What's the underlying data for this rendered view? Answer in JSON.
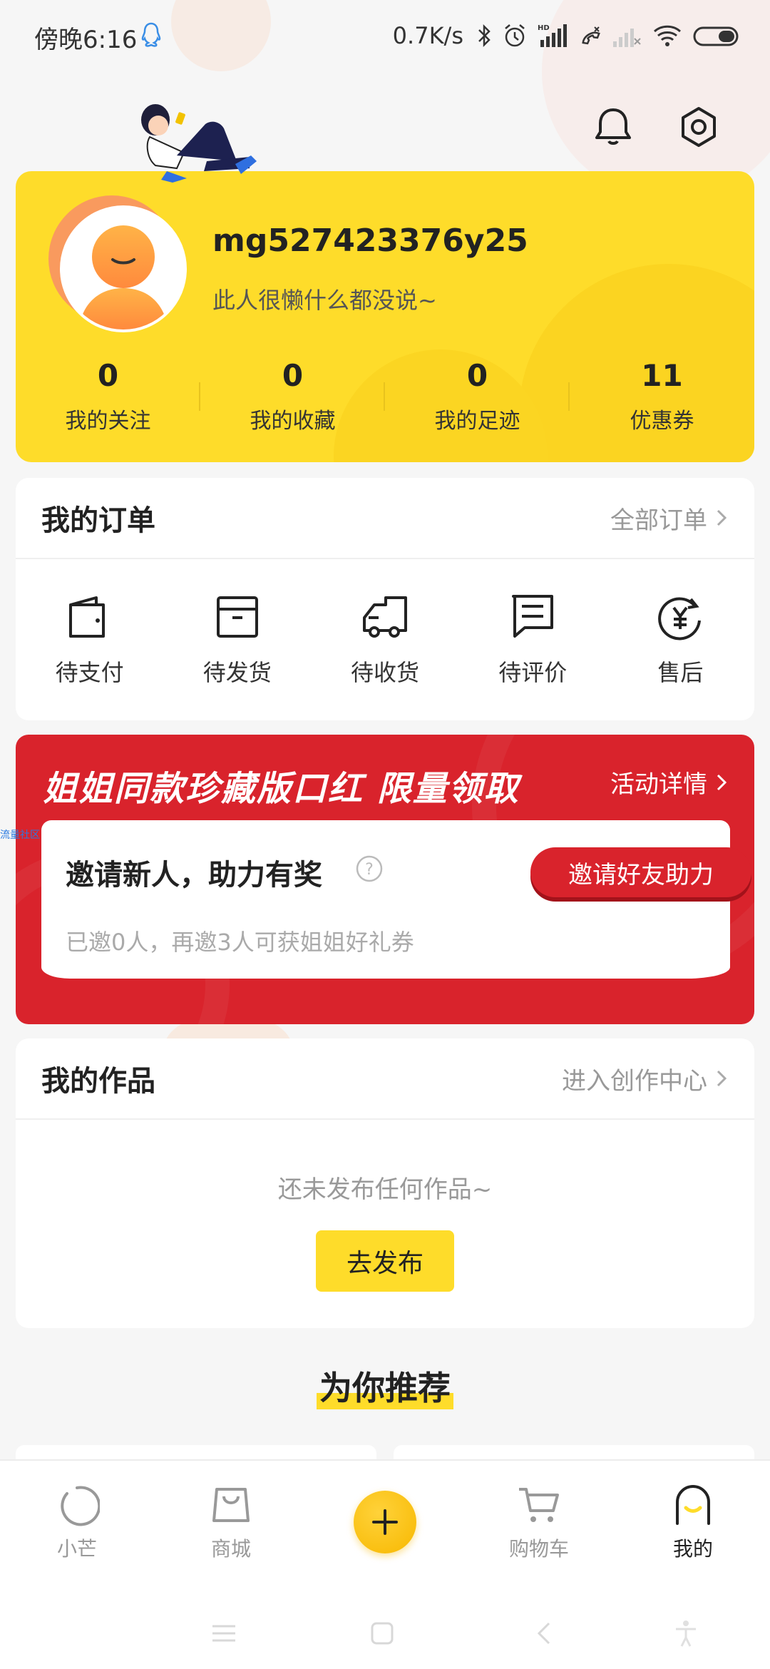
{
  "status_bar": {
    "time": "傍晚6:16",
    "network_speed": "0.7K/s",
    "icons": [
      "qq-icon",
      "bluetooth-icon",
      "alarm-icon",
      "signal-hd-icon",
      "call-icon",
      "signal-2-icon",
      "wifi-icon",
      "battery-icon"
    ]
  },
  "header": {
    "icons": [
      "bell-icon",
      "settings-icon"
    ]
  },
  "profile": {
    "username": "mg527423376y25",
    "bio": "此人很懒什么都没说~",
    "stats": [
      {
        "value": "0",
        "label": "我的关注"
      },
      {
        "value": "0",
        "label": "我的收藏"
      },
      {
        "value": "0",
        "label": "我的足迹"
      },
      {
        "value": "11",
        "label": "优惠券"
      }
    ]
  },
  "orders": {
    "title": "我的订单",
    "all_link": "全部订单",
    "items": [
      {
        "label": "待支付",
        "icon": "wallet-icon"
      },
      {
        "label": "待发货",
        "icon": "box-icon"
      },
      {
        "label": "待收货",
        "icon": "truck-icon"
      },
      {
        "label": "待评价",
        "icon": "comment-icon"
      },
      {
        "label": "售后",
        "icon": "refund-icon"
      }
    ]
  },
  "promo": {
    "title": "姐姐同款珍藏版口红 限量领取",
    "detail_link": "活动详情",
    "invite_title": "邀请新人，助力有奖",
    "invite_button": "邀请好友助力",
    "invite_sub": "已邀0人，再邀3人可获姐姐好礼券",
    "overlay_tag": "流量社区"
  },
  "works": {
    "title": "我的作品",
    "center_link": "进入创作中心",
    "empty_text": "还未发布任何作品~",
    "publish_button": "去发布"
  },
  "recommend": {
    "title": "为你推荐"
  },
  "tabbar": {
    "tabs": [
      {
        "label": "小芒",
        "icon": "xiaomang-icon"
      },
      {
        "label": "商城",
        "icon": "shop-bag-icon"
      },
      {
        "label": "",
        "icon": "plus-icon"
      },
      {
        "label": "购物车",
        "icon": "cart-icon"
      },
      {
        "label": "我的",
        "icon": "profile-icon"
      }
    ]
  },
  "system_nav": [
    "menu-icon",
    "home-icon",
    "back-icon",
    "accessibility-icon"
  ],
  "colors": {
    "accent_yellow": "#fedc2a",
    "promo_red": "#d9232c",
    "background": "#f6f6f6"
  }
}
